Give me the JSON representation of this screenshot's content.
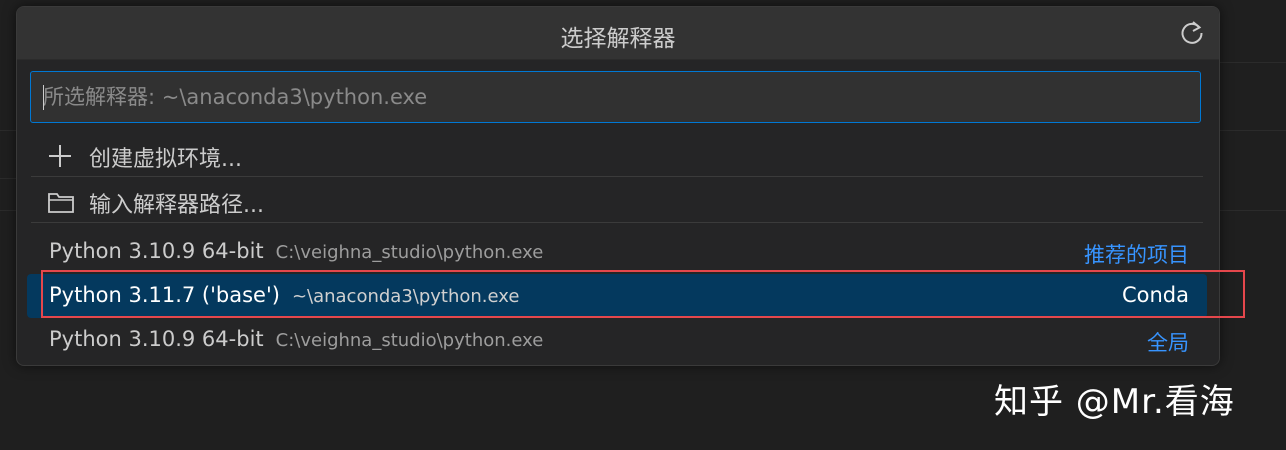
{
  "quick_pick": {
    "title": "选择解释器",
    "refresh_icon": "refresh-icon",
    "input": {
      "value": "",
      "placeholder": "所选解释器: ~\\anaconda3\\python.exe"
    },
    "actions": [
      {
        "icon": "plus-icon",
        "label": "创建虚拟环境..."
      },
      {
        "icon": "folder-icon",
        "label": "输入解释器路径..."
      }
    ],
    "interpreters": [
      {
        "label": "Python 3.10.9 64-bit",
        "path": "C:\\veighna_studio\\python.exe",
        "tag": "推荐的项目",
        "selected": false
      },
      {
        "label": "Python 3.11.7 ('base')",
        "path": "~\\anaconda3\\python.exe",
        "tag": "Conda",
        "selected": true
      },
      {
        "label": "Python 3.10.9 64-bit",
        "path": "C:\\veighna_studio\\python.exe",
        "tag": "全局",
        "selected": false
      }
    ]
  },
  "watermark": "知乎 @Mr.看海",
  "colors": {
    "accent": "#0078d4",
    "selection": "#04395e",
    "tag_link": "#3794ff",
    "annotation_box": "#e5474c"
  }
}
